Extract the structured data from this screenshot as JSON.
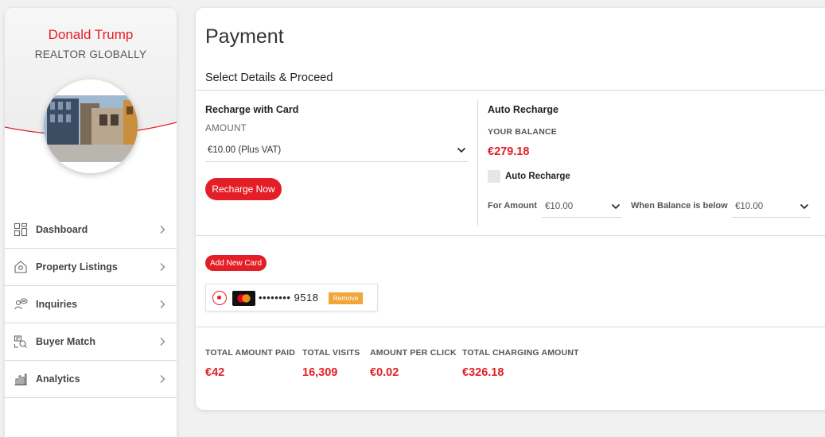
{
  "profile": {
    "name": "Donald Trump",
    "role": "REALTOR GLOBALLY"
  },
  "nav": [
    {
      "label": "Dashboard",
      "icon": "dashboard-grid-icon"
    },
    {
      "label": "Property Listings",
      "icon": "house-icon"
    },
    {
      "label": "Inquiries",
      "icon": "people-chat-icon"
    },
    {
      "label": "Buyer Match",
      "icon": "buyer-match-icon"
    },
    {
      "label": "Analytics",
      "icon": "bar-chart-icon"
    }
  ],
  "page": {
    "title": "Payment",
    "section_title": "Select Details & Proceed"
  },
  "recharge_card": {
    "title": "Recharge with Card",
    "amount_label": "AMOUNT",
    "amount_value": "€10.00 (Plus VAT)",
    "button": "Recharge Now"
  },
  "auto_recharge": {
    "title": "Auto Recharge",
    "balance_label": "YOUR BALANCE",
    "balance_value": "€279.18",
    "checkbox_label": "Auto Recharge",
    "for_amount_label": "For Amount",
    "for_amount_value": "€10.00",
    "when_below_label": "When Balance is below",
    "when_below_value": "€10.00"
  },
  "cards": {
    "add_button": "Add New Card",
    "saved_mask": "•••••••• 9518",
    "remove_label": "Remove"
  },
  "stats": [
    {
      "label": "TOTAL AMOUNT PAID",
      "value": "€42"
    },
    {
      "label": "TOTAL VISITS",
      "value": "16,309"
    },
    {
      "label": "AMOUNT PER CLICK",
      "value": "€0.02"
    },
    {
      "label": "TOTAL CHARGING AMOUNT",
      "value": "€326.18"
    }
  ],
  "colors": {
    "accent": "#e41e26",
    "remove": "#f2a63a"
  }
}
